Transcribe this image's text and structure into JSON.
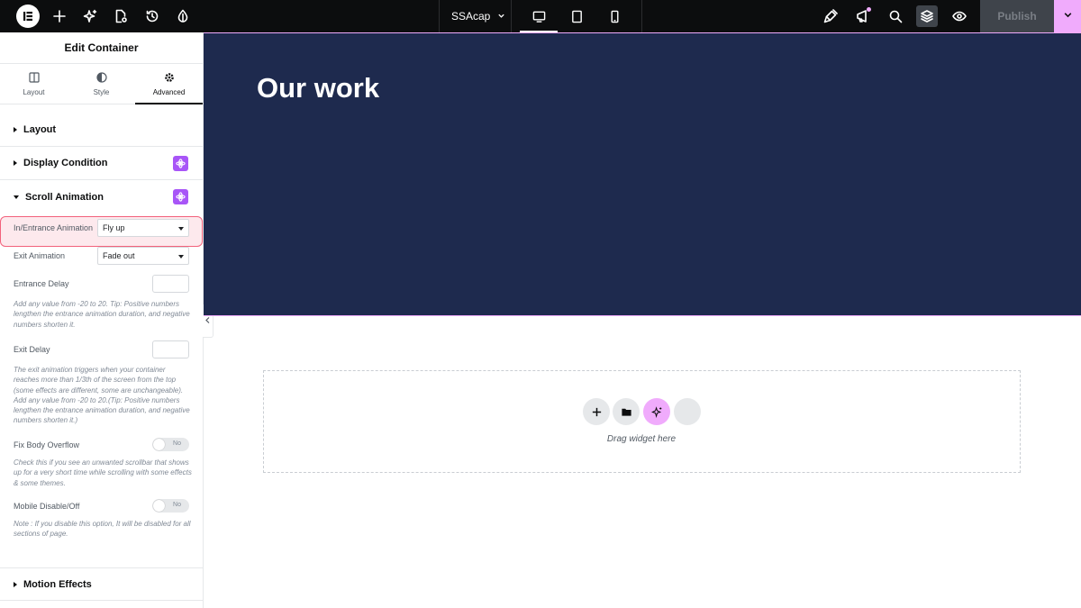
{
  "topbar": {
    "site_name": "SSAcap",
    "publish_label": "Publish",
    "icons": [
      "elementor-logo-icon",
      "add-element-icon",
      "ai-sparkle-icon",
      "page-settings-icon",
      "history-icon",
      "site-settings-icon",
      "desktop-icon",
      "tablet-icon",
      "mobile-icon",
      "integrations-icon",
      "whats-new-icon",
      "search-icon",
      "structure-icon",
      "preview-icon"
    ]
  },
  "panel": {
    "title": "Edit Container",
    "tabs": [
      {
        "label": "Layout"
      },
      {
        "label": "Style"
      },
      {
        "label": "Advanced"
      }
    ],
    "sections": {
      "layout": "Layout",
      "display_condition": "Display Condition",
      "scroll_animation": "Scroll Animation",
      "motion_effects": "Motion Effects"
    },
    "controls": {
      "entrance_label": "In/Entrance Animation",
      "entrance_value": "Fly up",
      "exit_label": "Exit Animation",
      "exit_value": "Fade out",
      "entrance_delay_label": "Entrance Delay",
      "entrance_delay_note": "Add any value from -20 to 20. Tip: Positive numbers lengthen the entrance animation duration, and negative numbers shorten it.",
      "exit_delay_label": "Exit Delay",
      "exit_delay_note": "The exit animation triggers when your container reaches more than 1/3th of the screen from the top (some effects are different, some are unchangeable). Add any value from -20 to 20.(Tip: Positive numbers lengthen the entrance animation duration, and negative numbers shorten it.)",
      "fix_overflow_label": "Fix Body Overflow",
      "fix_overflow_value": "No",
      "fix_overflow_note": "Check this if you see an unwanted scrollbar that shows up for a very short time while scrolling with some effects & some themes.",
      "mobile_disable_label": "Mobile Disable/Off",
      "mobile_disable_value": "No",
      "mobile_disable_note": "Note : If you disable this option, It will be disabled for all sections of page."
    }
  },
  "canvas": {
    "heading": "Our work",
    "drop_label": "Drag widget here"
  },
  "colors": {
    "hero_bg": "#1e2a4e",
    "accent_pink": "#f0abfc",
    "pro_purple": "#a855f7",
    "highlight": "#f2627c"
  }
}
